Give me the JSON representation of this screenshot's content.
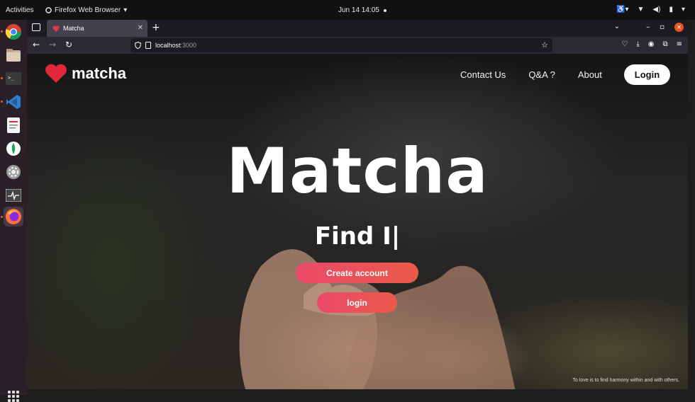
{
  "system_bar": {
    "activities": "Activities",
    "app_menu": "Firefox Web Browser",
    "clock": "Jun 14  14:05"
  },
  "dock": {
    "items": [
      {
        "name": "chrome",
        "color": "#db4437"
      },
      {
        "name": "files",
        "color": "#c9b39b"
      },
      {
        "name": "terminal",
        "color": "#3a3a3a"
      },
      {
        "name": "vscode",
        "color": "#2f80d1"
      },
      {
        "name": "text-editor",
        "color": "#e8e8e8"
      },
      {
        "name": "mongodb-compass",
        "color": "#13aa52"
      },
      {
        "name": "settings",
        "color": "#9a9a9a"
      },
      {
        "name": "system-monitor",
        "color": "#444"
      },
      {
        "name": "firefox",
        "color": "#ff7139"
      }
    ]
  },
  "browser": {
    "tab_title": "Matcha",
    "url_host": "localhost",
    "url_port": ":3000"
  },
  "page": {
    "brand": "matcha",
    "nav": [
      "Contact Us",
      "Q&A ?",
      "About"
    ],
    "login_top": "Login",
    "hero_title": "Matcha",
    "hero_sub": "Find I|",
    "create_account": "Create account",
    "login_btn": "login",
    "quote": "To love is to find harmony within and with others.",
    "accent": "#e94a6a"
  }
}
